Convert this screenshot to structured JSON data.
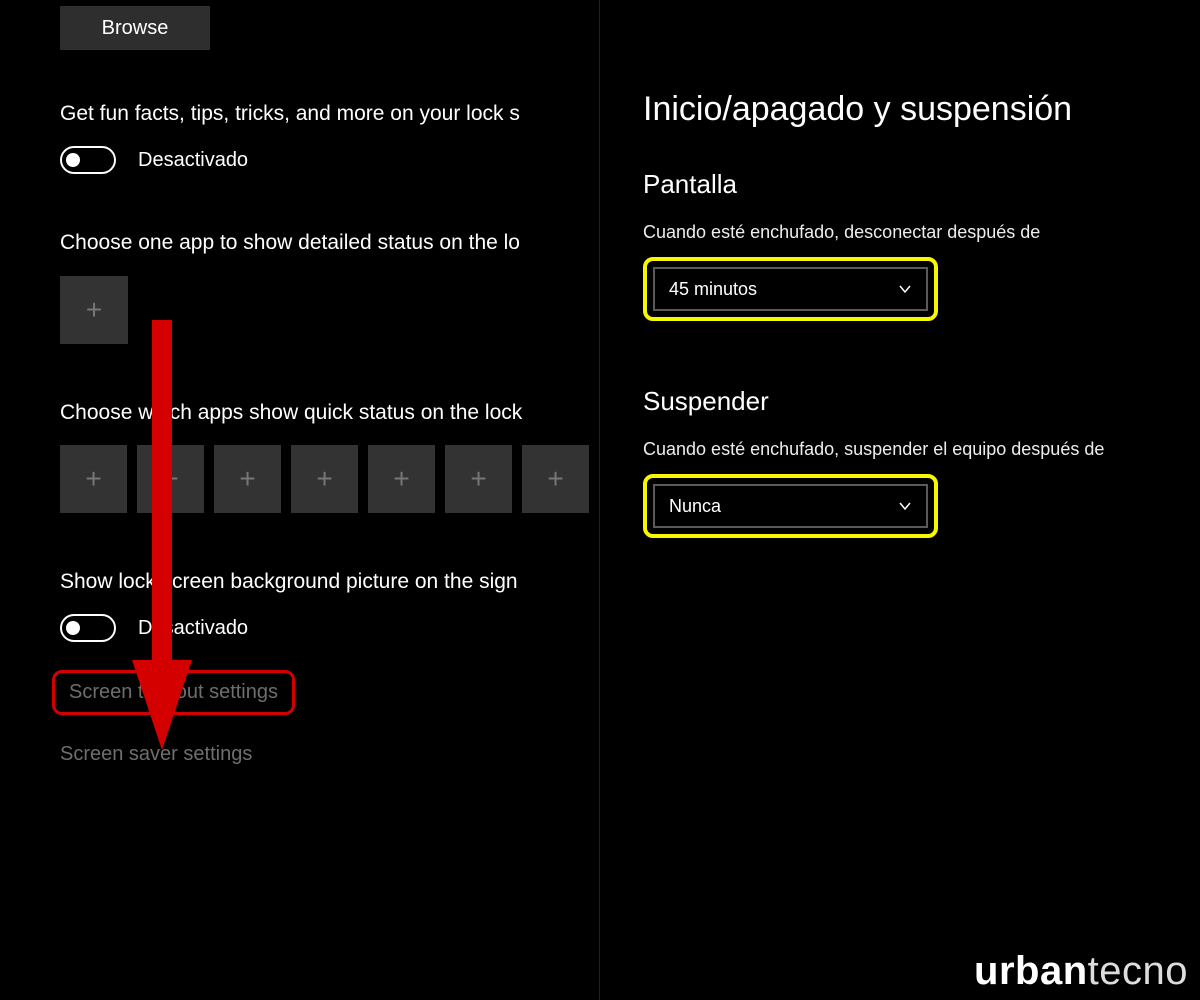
{
  "left": {
    "browse": "Browse",
    "funfacts_label": "Get fun facts, tips, tricks, and more on your lock s",
    "funfacts_state": "Desactivado",
    "detailed_status_label": "Choose one app to show detailed status on the lo",
    "quick_status_label": "Choose which apps show quick status on the lock",
    "signin_bg_label": "Show lock screen background picture on the sign",
    "signin_bg_state": "Desactivado",
    "link_timeout": "Screen timeout settings",
    "link_screensaver": "Screen saver settings"
  },
  "right": {
    "title": "Inicio/apagado y suspensión",
    "screen_heading": "Pantalla",
    "screen_sub": "Cuando esté enchufado, desconectar después de",
    "screen_value": "45 minutos",
    "sleep_heading": "Suspender",
    "sleep_sub": "Cuando esté enchufado, suspender el equipo después de",
    "sleep_value": "Nunca"
  },
  "watermark": {
    "a": "urban",
    "b": "tecno"
  }
}
